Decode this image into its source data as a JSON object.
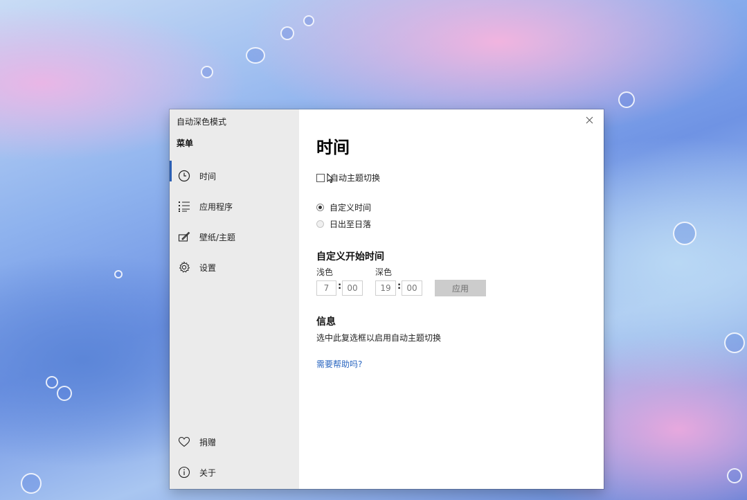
{
  "window": {
    "app_title": "自动深色模式",
    "close_icon": "close-icon"
  },
  "sidebar": {
    "menu_label": "菜单",
    "items": [
      {
        "label": "时间",
        "icon": "clock-icon",
        "selected": true
      },
      {
        "label": "应用程序",
        "icon": "list-icon",
        "selected": false
      },
      {
        "label": "壁纸/主题",
        "icon": "paint-icon",
        "selected": false
      },
      {
        "label": "设置",
        "icon": "gear-icon",
        "selected": false
      }
    ],
    "bottom_items": [
      {
        "label": "捐赠",
        "icon": "heart-icon"
      },
      {
        "label": "关于",
        "icon": "info-icon"
      }
    ]
  },
  "main": {
    "title": "时间",
    "auto_switch_checkbox": {
      "label": "自动主题切换",
      "checked": false
    },
    "radios": [
      {
        "label": "自定义时间",
        "selected": true
      },
      {
        "label": "日出至日落",
        "selected": false
      }
    ],
    "custom_section": {
      "heading": "自定义开始时间",
      "light_label": "浅色",
      "dark_label": "深色",
      "light_hour": "7",
      "light_minute": "00",
      "dark_hour": "19",
      "dark_minute": "00",
      "colon": ":",
      "apply_label": "应用"
    },
    "info_section": {
      "heading": "信息",
      "text": "选中此复选框以启用自动主题切换",
      "help_link": "需要帮助吗?"
    }
  },
  "colors": {
    "accent": "#2b5fb4",
    "link": "#2a66c0",
    "sidebar_bg": "#ebebeb"
  }
}
